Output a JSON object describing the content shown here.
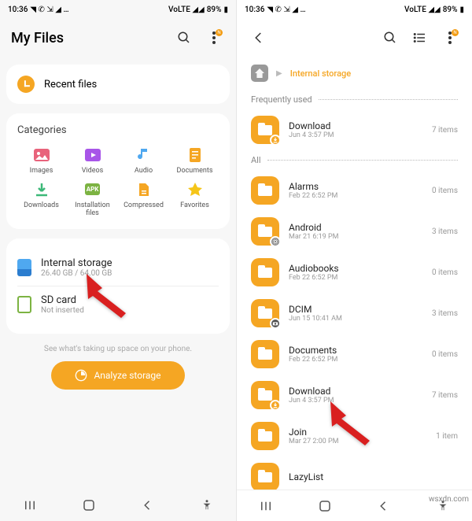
{
  "status": {
    "time": "10:36",
    "battery": "89%"
  },
  "left": {
    "title": "My Files",
    "recent_label": "Recent files",
    "categories_title": "Categories",
    "categories": [
      {
        "label": "Images"
      },
      {
        "label": "Videos"
      },
      {
        "label": "Audio"
      },
      {
        "label": "Documents"
      },
      {
        "label": "Downloads"
      },
      {
        "label": "Installation files"
      },
      {
        "label": "Compressed"
      },
      {
        "label": "Favorites"
      }
    ],
    "storage": {
      "internal": {
        "title": "Internal storage",
        "sub": "26.40 GB / 64.00 GB"
      },
      "sd": {
        "title": "SD card",
        "sub": "Not inserted"
      }
    },
    "hint": "See what's taking up space on your phone.",
    "analyze_label": "Analyze storage"
  },
  "right": {
    "breadcrumb": "Internal storage",
    "freq_label": "Frequently used",
    "all_label": "All",
    "freq_folders": [
      {
        "name": "Download",
        "sub": "Jun 4 3:57 PM",
        "count": "7 items",
        "badge": true
      }
    ],
    "folders": [
      {
        "name": "Alarms",
        "sub": "Feb 22 6:52 PM",
        "count": "0 items"
      },
      {
        "name": "Android",
        "sub": "Mar 21 6:19 PM",
        "count": "3 items",
        "gear": true
      },
      {
        "name": "Audiobooks",
        "sub": "Feb 22 6:52 PM",
        "count": "0 items"
      },
      {
        "name": "DCIM",
        "sub": "Jun 15 10:41 AM",
        "count": "3 items",
        "cam": true
      },
      {
        "name": "Documents",
        "sub": "Feb 22 6:52 PM",
        "count": "0 items"
      },
      {
        "name": "Download",
        "sub": "Jun 4 3:57 PM",
        "count": "7 items",
        "badge": true
      },
      {
        "name": "Join",
        "sub": "Mar 27 2:00 PM",
        "count": "1 item"
      },
      {
        "name": "LazyList",
        "sub": "",
        "count": ""
      }
    ]
  },
  "watermark": "wsxdn.com"
}
